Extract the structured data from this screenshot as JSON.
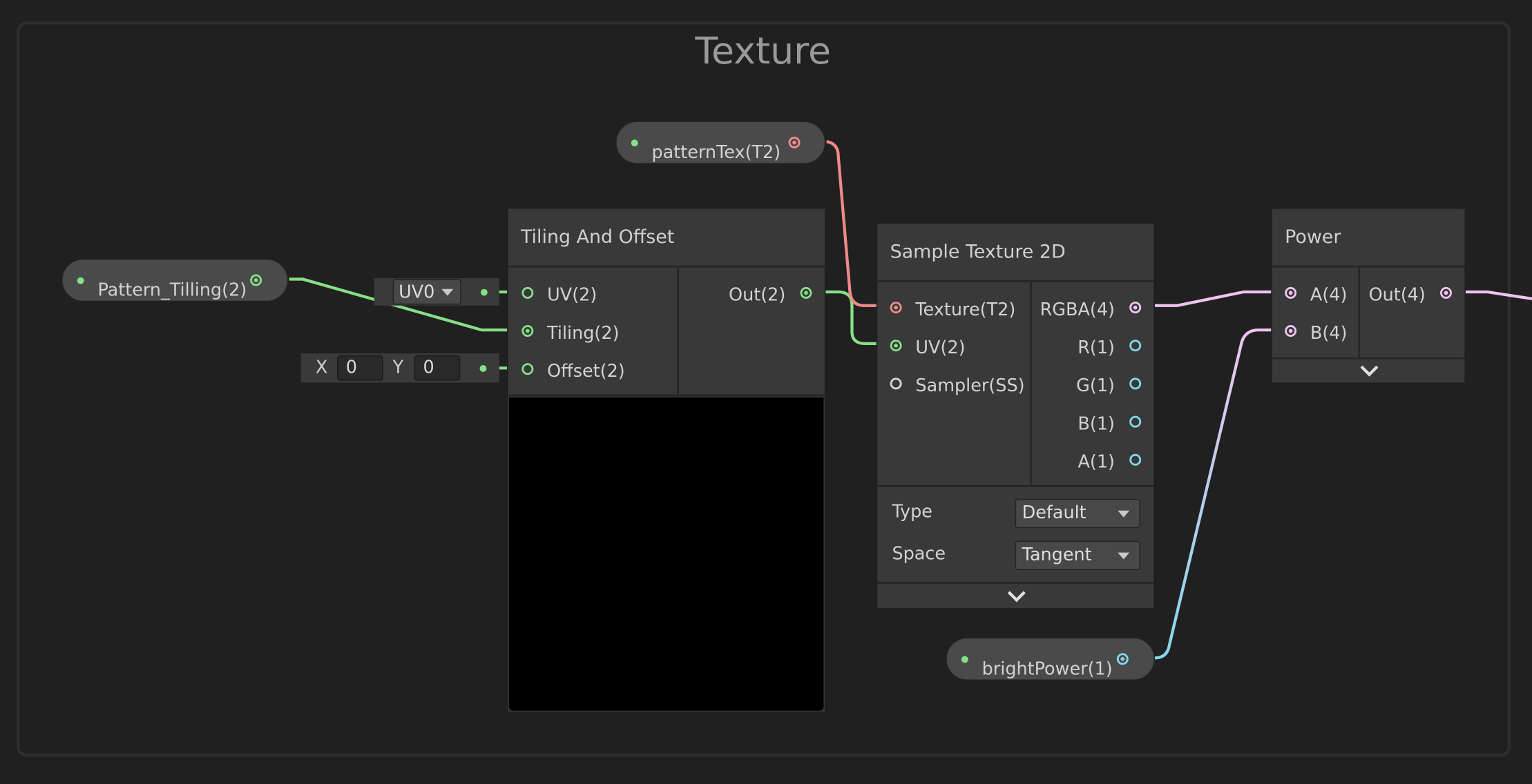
{
  "group": {
    "title": "Texture"
  },
  "pattern_tex": {
    "label": "patternTex(T2)"
  },
  "pattern_tilling": {
    "label": "Pattern_Tilling(2)"
  },
  "bright_power": {
    "label": "brightPower(1)"
  },
  "uv_channel": {
    "value": "UV0"
  },
  "offset_fields": {
    "x_label": "X",
    "x_value": "0",
    "y_label": "Y",
    "y_value": "0"
  },
  "tiling_offset": {
    "title": "Tiling And Offset",
    "inputs": [
      "UV(2)",
      "Tiling(2)",
      "Offset(2)"
    ],
    "output": "Out(2)"
  },
  "sample_texture": {
    "title": "Sample Texture 2D",
    "inputs": [
      "Texture(T2)",
      "UV(2)",
      "Sampler(SS)"
    ],
    "outputs": [
      "RGBA(4)",
      "R(1)",
      "G(1)",
      "B(1)",
      "A(1)"
    ],
    "type_label": "Type",
    "type_value": "Default",
    "space_label": "Space",
    "space_value": "Tangent"
  },
  "power": {
    "title": "Power",
    "inputs": [
      "A(4)",
      "B(4)"
    ],
    "output": "Out(4)"
  },
  "colors": {
    "vector2": "#86e086",
    "texture": "#f08a8a",
    "vector4": "#f0c4f0",
    "vector1": "#84d8e8"
  }
}
